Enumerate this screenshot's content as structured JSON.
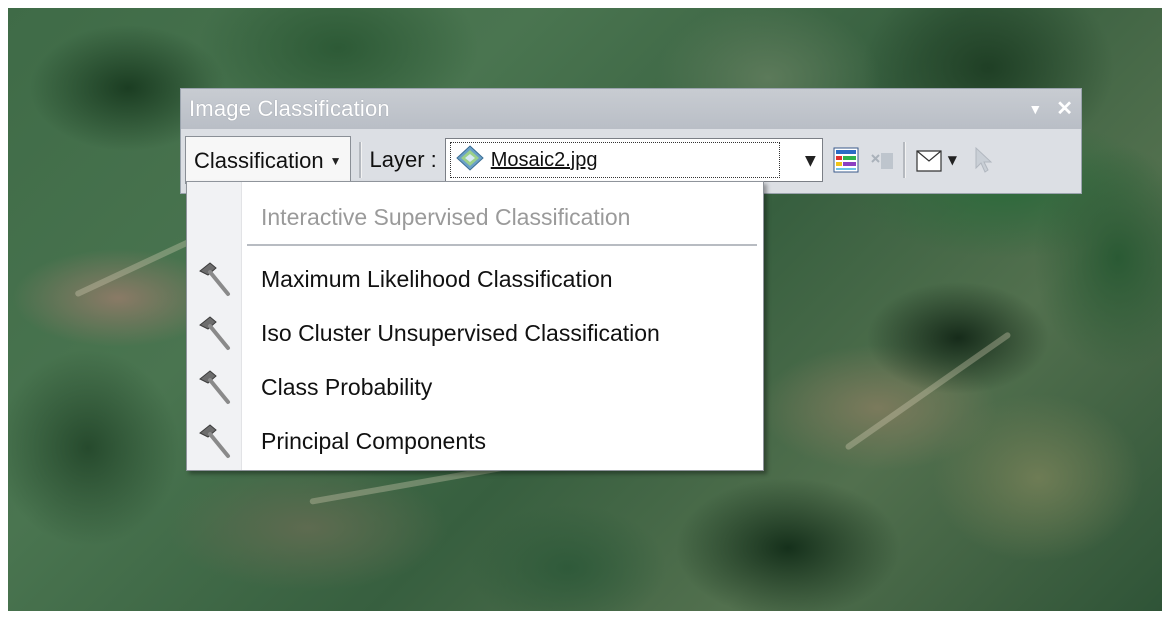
{
  "window": {
    "title": "Image Classification",
    "pin_glyph": "▼",
    "close_glyph": "✕"
  },
  "toolbar": {
    "classification_label": "Classification",
    "layer_label": "Layer :",
    "layer_value": "Mosaic2.jpg"
  },
  "menu": {
    "items": [
      {
        "label": "Interactive Supervised Classification",
        "enabled": false
      },
      {
        "label": "Maximum Likelihood Classification",
        "enabled": true,
        "icon": "hammer-icon"
      },
      {
        "label": "Iso Cluster Unsupervised Classification",
        "enabled": true,
        "icon": "hammer-icon"
      },
      {
        "label": "Class Probability",
        "enabled": true,
        "icon": "hammer-icon"
      },
      {
        "label": "Principal Components",
        "enabled": true,
        "icon": "hammer-icon"
      }
    ]
  },
  "colors": {
    "titlebar": "#b9bec6",
    "toolbar_bg": "#dcdfe4",
    "disabled_text": "#9a9a9a"
  }
}
